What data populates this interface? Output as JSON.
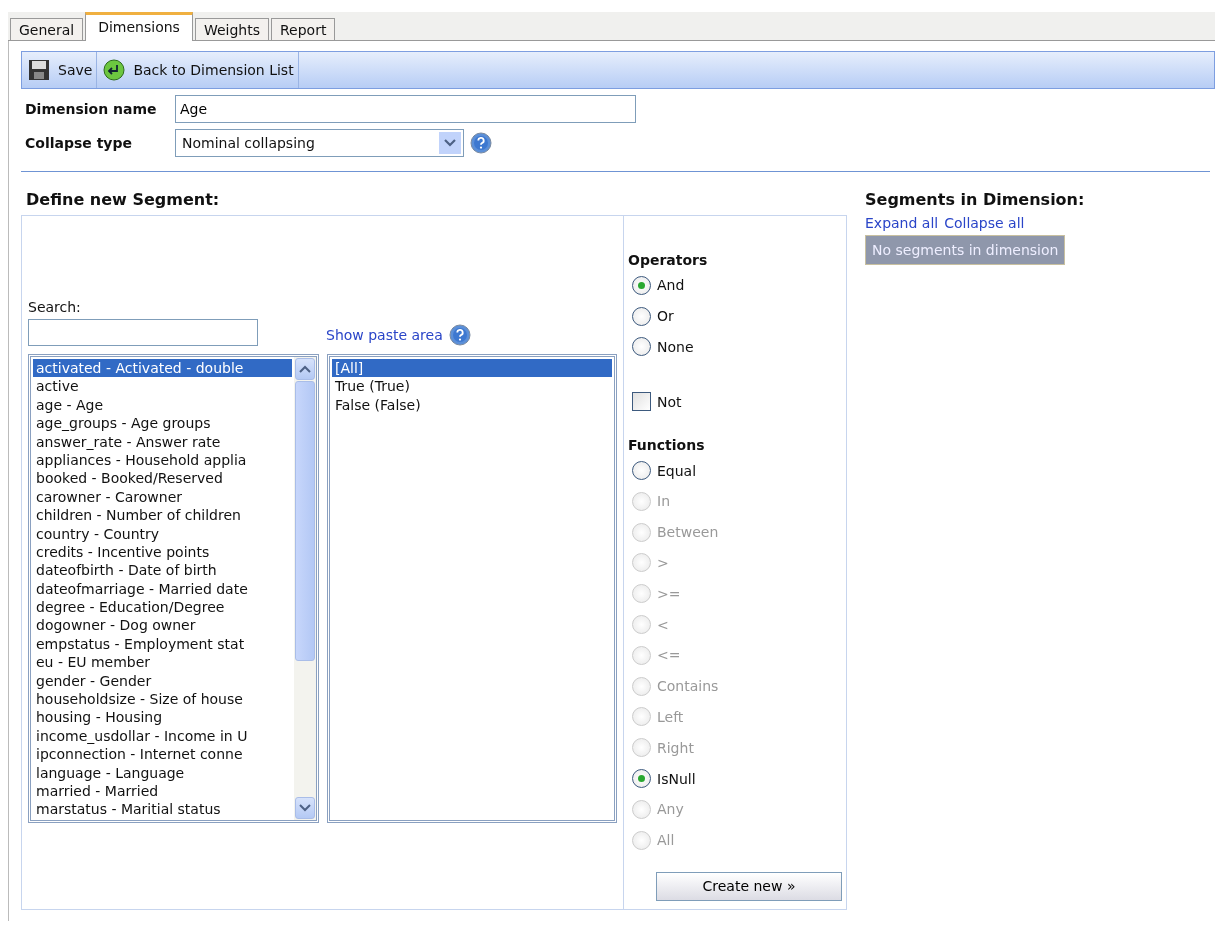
{
  "tabs": [
    {
      "label": "General",
      "selected": false
    },
    {
      "label": "Dimensions",
      "selected": true
    },
    {
      "label": "Weights",
      "selected": false
    },
    {
      "label": "Report",
      "selected": false
    }
  ],
  "toolbar": [
    {
      "label": "Save",
      "kind": "save"
    },
    {
      "label": "Back to Dimension List",
      "kind": "back"
    }
  ],
  "form": {
    "name_label": "Dimension name",
    "name_value": "Age",
    "collapse_label": "Collapse type",
    "collapse_value": "Nominal collapsing"
  },
  "define": {
    "title": "Define new Segment:",
    "search_label": "Search:",
    "paste_link": "Show paste area",
    "variables": [
      {
        "label": "activated - Activated - double",
        "selected": true
      },
      {
        "label": "active",
        "selected": false
      },
      {
        "label": "age - Age",
        "selected": false
      },
      {
        "label": "age_groups - Age groups",
        "selected": false
      },
      {
        "label": "answer_rate - Answer rate",
        "selected": false
      },
      {
        "label": "appliances - Household applia",
        "selected": false
      },
      {
        "label": "booked - Booked/Reserved",
        "selected": false
      },
      {
        "label": "carowner - Carowner",
        "selected": false
      },
      {
        "label": "children - Number of children",
        "selected": false
      },
      {
        "label": "country - Country",
        "selected": false
      },
      {
        "label": "credits - Incentive points",
        "selected": false
      },
      {
        "label": "dateofbirth - Date of birth",
        "selected": false
      },
      {
        "label": "dateofmarriage - Married date",
        "selected": false
      },
      {
        "label": "degree - Education/Degree",
        "selected": false
      },
      {
        "label": "dogowner - Dog owner",
        "selected": false
      },
      {
        "label": "empstatus - Employment stat",
        "selected": false
      },
      {
        "label": "eu - EU member",
        "selected": false
      },
      {
        "label": "gender - Gender",
        "selected": false
      },
      {
        "label": "householdsize - Size of house",
        "selected": false
      },
      {
        "label": "housing - Housing",
        "selected": false
      },
      {
        "label": "income_usdollar - Income in U",
        "selected": false
      },
      {
        "label": "ipconnection - Internet conne",
        "selected": false
      },
      {
        "label": "language - Language",
        "selected": false
      },
      {
        "label": "married - Married",
        "selected": false
      },
      {
        "label": "marstatus - Maritial status",
        "selected": false
      }
    ],
    "values": [
      {
        "label": "[All]",
        "selected": true
      },
      {
        "label": "True (True)",
        "selected": false
      },
      {
        "label": "False (False)",
        "selected": false
      }
    ],
    "operators_title": "Operators",
    "operators": [
      {
        "label": "And",
        "selected": true
      },
      {
        "label": "Or",
        "selected": false
      },
      {
        "label": "None",
        "selected": false
      }
    ],
    "not": {
      "label": "Not",
      "checked": false
    },
    "functions_title": "Functions",
    "functions": [
      {
        "label": "Equal",
        "selected": false,
        "disabled": false
      },
      {
        "label": "In",
        "selected": false,
        "disabled": true
      },
      {
        "label": "Between",
        "selected": false,
        "disabled": true
      },
      {
        "label": ">",
        "selected": false,
        "disabled": true
      },
      {
        "label": ">=",
        "selected": false,
        "disabled": true
      },
      {
        "label": "<",
        "selected": false,
        "disabled": true
      },
      {
        "label": "<=",
        "selected": false,
        "disabled": true
      },
      {
        "label": "Contains",
        "selected": false,
        "disabled": true
      },
      {
        "label": "Left",
        "selected": false,
        "disabled": true
      },
      {
        "label": "Right",
        "selected": false,
        "disabled": true
      },
      {
        "label": "IsNull",
        "selected": true,
        "disabled": false
      },
      {
        "label": "Any",
        "selected": false,
        "disabled": true
      },
      {
        "label": "All",
        "selected": false,
        "disabled": true
      }
    ],
    "create_button": "Create new »"
  },
  "segments": {
    "title": "Segments in Dimension:",
    "expand": "Expand all",
    "collapse": "Collapse all",
    "empty": "No segments in dimension"
  }
}
